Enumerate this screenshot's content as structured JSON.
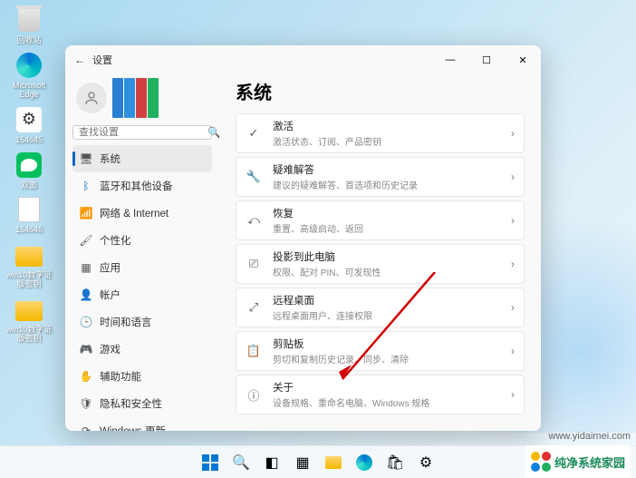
{
  "desktop": {
    "icons": [
      {
        "label": "回收站",
        "type": "bin"
      },
      {
        "label": "Microsoft Edge",
        "type": "edge"
      },
      {
        "label": "154645",
        "type": "gear"
      },
      {
        "label": "双面",
        "type": "wechat"
      },
      {
        "label": "154646",
        "type": "txt"
      },
      {
        "label": "win10数字证版密钥",
        "type": "folder"
      },
      {
        "label": "win10数字证版密钥",
        "type": "folder"
      }
    ]
  },
  "window": {
    "title": "设置",
    "back_glyph": "←",
    "min_glyph": "—",
    "max_glyph": "☐",
    "close_glyph": "✕"
  },
  "search": {
    "placeholder": "查找设置",
    "icon": "🔍"
  },
  "sidebar": {
    "items": [
      {
        "icon": "🖥",
        "label": "系统",
        "active": true
      },
      {
        "icon": "ᛒ",
        "label": "蓝牙和其他设备",
        "color": "#0067c0"
      },
      {
        "icon": "📶",
        "label": "网络 & Internet"
      },
      {
        "icon": "🖌",
        "label": "个性化"
      },
      {
        "icon": "▦",
        "label": "应用"
      },
      {
        "icon": "👤",
        "label": "帐户"
      },
      {
        "icon": "🕒",
        "label": "时间和语言"
      },
      {
        "icon": "🎮",
        "label": "游戏"
      },
      {
        "icon": "✋",
        "label": "辅助功能"
      },
      {
        "icon": "🛡",
        "label": "隐私和安全性"
      },
      {
        "icon": "⟳",
        "label": "Windows 更新"
      }
    ]
  },
  "content": {
    "heading": "系统",
    "cards": [
      {
        "icon": "✓",
        "title": "激活",
        "sub": "激活状态、订阅、产品密钥"
      },
      {
        "icon": "🔧",
        "title": "疑难解答",
        "sub": "建议的疑难解答、首选项和历史记录"
      },
      {
        "icon": "⤺",
        "title": "恢复",
        "sub": "重置、高级启动、返回"
      },
      {
        "icon": "⎚",
        "title": "投影到此电脑",
        "sub": "权限、配对 PIN、可发现性"
      },
      {
        "icon": "⤢",
        "title": "远程桌面",
        "sub": "远程桌面用户、连接权限"
      },
      {
        "icon": "📋",
        "title": "剪贴板",
        "sub": "剪切和复制历史记录、同步、清除"
      },
      {
        "icon": "ⓘ",
        "title": "关于",
        "sub": "设备规格、重命名电脑、Windows 规格"
      }
    ],
    "chevron": "›"
  },
  "watermark": "www.yidaimei.com",
  "brand": "纯净系统家园"
}
